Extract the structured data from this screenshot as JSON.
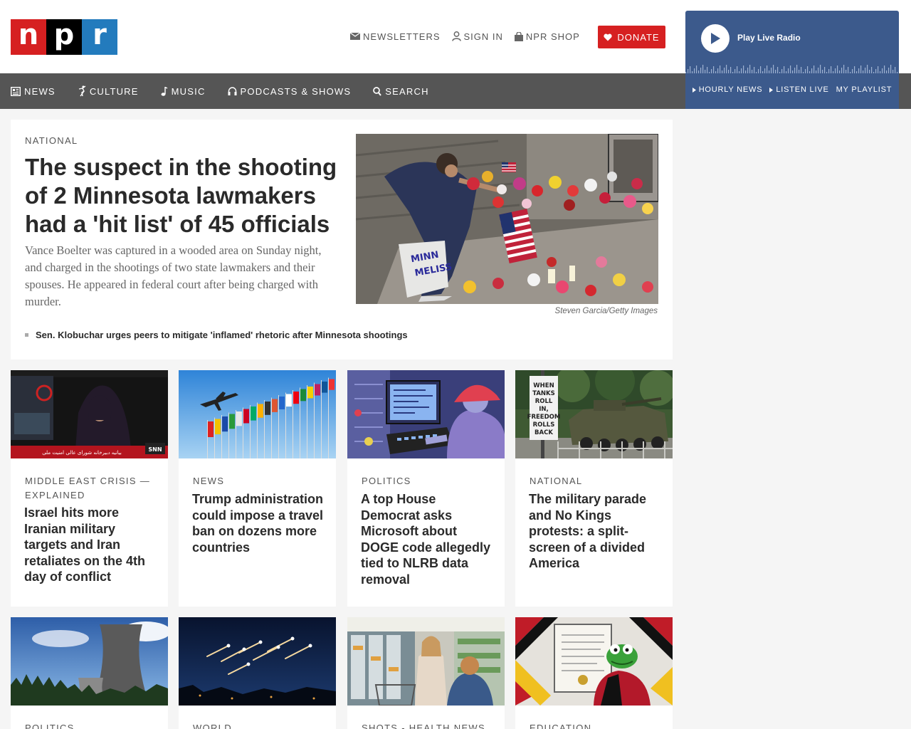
{
  "logo": {
    "letters": [
      "n",
      "p",
      "r"
    ]
  },
  "header": {
    "newsletters": "NEWSLETTERS",
    "sign_in": "SIGN IN",
    "shop": "NPR SHOP",
    "donate": "DONATE"
  },
  "player": {
    "label": "Play Live Radio",
    "links": [
      "HOURLY NEWS",
      "LISTEN LIVE",
      "MY PLAYLIST"
    ]
  },
  "nav": {
    "items": [
      {
        "label": "NEWS",
        "icon": "newspaper-icon"
      },
      {
        "label": "CULTURE",
        "icon": "dancer-icon"
      },
      {
        "label": "MUSIC",
        "icon": "music-note-icon"
      },
      {
        "label": "PODCASTS & SHOWS",
        "icon": "headphones-icon"
      },
      {
        "label": "SEARCH",
        "icon": "search-icon"
      }
    ]
  },
  "featured": {
    "slug": "NATIONAL",
    "headline": "The suspect in the shooting of 2 Minnesota lawmakers had a 'hit list' of 45 officials",
    "teaser": "Vance Boelter was captured in a wooded area on Sunday night, and charged in the shootings of two state lawmakers and their spouses. He appeared in federal court after being charged with murder.",
    "credit": "Steven Garcia/Getty Images",
    "related": "Sen. Klobuchar urges peers to mitigate 'inflamed' rhetoric after Minnesota shootings",
    "sign_text": "MINN\nMELISS"
  },
  "cards_row1": [
    {
      "slug": "MIDDLE EAST CRISIS — EXPLAINED",
      "headline": "Israel hits more Iranian military targets and Iran retaliates on the 4th day of conflict",
      "tv_label": "SNN",
      "tv_caption": "بیانیه دبیرخانه شورای عالی امنیت ملی"
    },
    {
      "slug": "NEWS",
      "headline": "Trump administration could impose a travel ban on dozens more countries"
    },
    {
      "slug": "POLITICS",
      "headline": "A top House Democrat asks Microsoft about DOGE code allegedly tied to NLRB data removal"
    },
    {
      "slug": "NATIONAL",
      "headline": "The military parade and No Kings protests: a split-screen of a divided America",
      "sign_text": "WHEN TANKS ROLL IN, FREEDOM ROLLS BACK"
    }
  ],
  "cards_row2": [
    {
      "slug": "POLITICS"
    },
    {
      "slug": "WORLD"
    },
    {
      "slug": "SHOTS - HEALTH NEWS"
    },
    {
      "slug": "EDUCATION"
    }
  ]
}
